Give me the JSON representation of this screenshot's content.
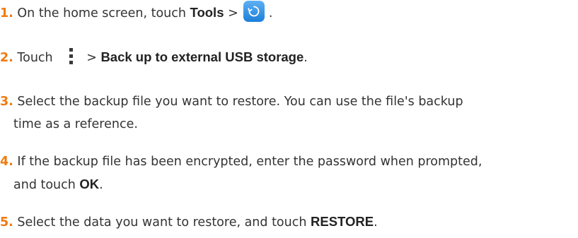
{
  "steps": [
    {
      "number": "1.",
      "text_a": "On the home screen, touch ",
      "bold_a": "Tools",
      "text_b": " > ",
      "icon": "backup-app-icon",
      "text_c": " ."
    },
    {
      "number": "2.",
      "text_a": "Touch ",
      "icon": "more-options-vertical-dots-icon",
      "text_b": "> ",
      "bold_a": "Back up to external USB storage",
      "text_c": "."
    },
    {
      "number": "3.",
      "line1": "Select the backup file you want to restore. You can use the file's backup",
      "line2": "time as a reference."
    },
    {
      "number": "4.",
      "line1": "If the backup file has been encrypted, enter the password when prompted,",
      "line2_a": "and touch ",
      "bold_a": "OK",
      "line2_b": "."
    },
    {
      "number": "5.",
      "text_a": "Select the data you want to restore, and touch ",
      "bold_a": "RESTORE",
      "text_b": "."
    }
  ],
  "colors": {
    "step_number": "#f07b0f",
    "body_text": "#333333",
    "app_icon_top": "#5fb0f2",
    "app_icon_bottom": "#1c7fd9"
  }
}
